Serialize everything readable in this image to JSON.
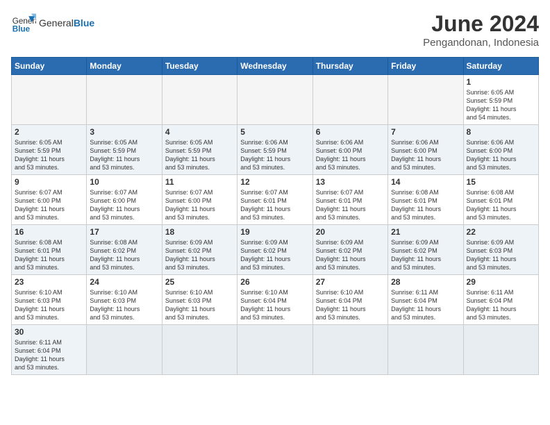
{
  "logo": {
    "text_general": "General",
    "text_blue": "Blue"
  },
  "header": {
    "month_year": "June 2024",
    "location": "Pengandonan, Indonesia"
  },
  "weekdays": [
    "Sunday",
    "Monday",
    "Tuesday",
    "Wednesday",
    "Thursday",
    "Friday",
    "Saturday"
  ],
  "weeks": [
    [
      {
        "day": "",
        "info": ""
      },
      {
        "day": "",
        "info": ""
      },
      {
        "day": "",
        "info": ""
      },
      {
        "day": "",
        "info": ""
      },
      {
        "day": "",
        "info": ""
      },
      {
        "day": "",
        "info": ""
      },
      {
        "day": "1",
        "info": "Sunrise: 6:05 AM\nSunset: 5:59 PM\nDaylight: 11 hours\nand 54 minutes."
      }
    ],
    [
      {
        "day": "2",
        "info": "Sunrise: 6:05 AM\nSunset: 5:59 PM\nDaylight: 11 hours\nand 53 minutes."
      },
      {
        "day": "3",
        "info": "Sunrise: 6:05 AM\nSunset: 5:59 PM\nDaylight: 11 hours\nand 53 minutes."
      },
      {
        "day": "4",
        "info": "Sunrise: 6:05 AM\nSunset: 5:59 PM\nDaylight: 11 hours\nand 53 minutes."
      },
      {
        "day": "5",
        "info": "Sunrise: 6:06 AM\nSunset: 5:59 PM\nDaylight: 11 hours\nand 53 minutes."
      },
      {
        "day": "6",
        "info": "Sunrise: 6:06 AM\nSunset: 6:00 PM\nDaylight: 11 hours\nand 53 minutes."
      },
      {
        "day": "7",
        "info": "Sunrise: 6:06 AM\nSunset: 6:00 PM\nDaylight: 11 hours\nand 53 minutes."
      },
      {
        "day": "8",
        "info": "Sunrise: 6:06 AM\nSunset: 6:00 PM\nDaylight: 11 hours\nand 53 minutes."
      }
    ],
    [
      {
        "day": "9",
        "info": "Sunrise: 6:07 AM\nSunset: 6:00 PM\nDaylight: 11 hours\nand 53 minutes."
      },
      {
        "day": "10",
        "info": "Sunrise: 6:07 AM\nSunset: 6:00 PM\nDaylight: 11 hours\nand 53 minutes."
      },
      {
        "day": "11",
        "info": "Sunrise: 6:07 AM\nSunset: 6:00 PM\nDaylight: 11 hours\nand 53 minutes."
      },
      {
        "day": "12",
        "info": "Sunrise: 6:07 AM\nSunset: 6:01 PM\nDaylight: 11 hours\nand 53 minutes."
      },
      {
        "day": "13",
        "info": "Sunrise: 6:07 AM\nSunset: 6:01 PM\nDaylight: 11 hours\nand 53 minutes."
      },
      {
        "day": "14",
        "info": "Sunrise: 6:08 AM\nSunset: 6:01 PM\nDaylight: 11 hours\nand 53 minutes."
      },
      {
        "day": "15",
        "info": "Sunrise: 6:08 AM\nSunset: 6:01 PM\nDaylight: 11 hours\nand 53 minutes."
      }
    ],
    [
      {
        "day": "16",
        "info": "Sunrise: 6:08 AM\nSunset: 6:01 PM\nDaylight: 11 hours\nand 53 minutes."
      },
      {
        "day": "17",
        "info": "Sunrise: 6:08 AM\nSunset: 6:02 PM\nDaylight: 11 hours\nand 53 minutes."
      },
      {
        "day": "18",
        "info": "Sunrise: 6:09 AM\nSunset: 6:02 PM\nDaylight: 11 hours\nand 53 minutes."
      },
      {
        "day": "19",
        "info": "Sunrise: 6:09 AM\nSunset: 6:02 PM\nDaylight: 11 hours\nand 53 minutes."
      },
      {
        "day": "20",
        "info": "Sunrise: 6:09 AM\nSunset: 6:02 PM\nDaylight: 11 hours\nand 53 minutes."
      },
      {
        "day": "21",
        "info": "Sunrise: 6:09 AM\nSunset: 6:02 PM\nDaylight: 11 hours\nand 53 minutes."
      },
      {
        "day": "22",
        "info": "Sunrise: 6:09 AM\nSunset: 6:03 PM\nDaylight: 11 hours\nand 53 minutes."
      }
    ],
    [
      {
        "day": "23",
        "info": "Sunrise: 6:10 AM\nSunset: 6:03 PM\nDaylight: 11 hours\nand 53 minutes."
      },
      {
        "day": "24",
        "info": "Sunrise: 6:10 AM\nSunset: 6:03 PM\nDaylight: 11 hours\nand 53 minutes."
      },
      {
        "day": "25",
        "info": "Sunrise: 6:10 AM\nSunset: 6:03 PM\nDaylight: 11 hours\nand 53 minutes."
      },
      {
        "day": "26",
        "info": "Sunrise: 6:10 AM\nSunset: 6:04 PM\nDaylight: 11 hours\nand 53 minutes."
      },
      {
        "day": "27",
        "info": "Sunrise: 6:10 AM\nSunset: 6:04 PM\nDaylight: 11 hours\nand 53 minutes."
      },
      {
        "day": "28",
        "info": "Sunrise: 6:11 AM\nSunset: 6:04 PM\nDaylight: 11 hours\nand 53 minutes."
      },
      {
        "day": "29",
        "info": "Sunrise: 6:11 AM\nSunset: 6:04 PM\nDaylight: 11 hours\nand 53 minutes."
      }
    ],
    [
      {
        "day": "30",
        "info": "Sunrise: 6:11 AM\nSunset: 6:04 PM\nDaylight: 11 hours\nand 53 minutes."
      },
      {
        "day": "",
        "info": ""
      },
      {
        "day": "",
        "info": ""
      },
      {
        "day": "",
        "info": ""
      },
      {
        "day": "",
        "info": ""
      },
      {
        "day": "",
        "info": ""
      },
      {
        "day": "",
        "info": ""
      }
    ]
  ]
}
